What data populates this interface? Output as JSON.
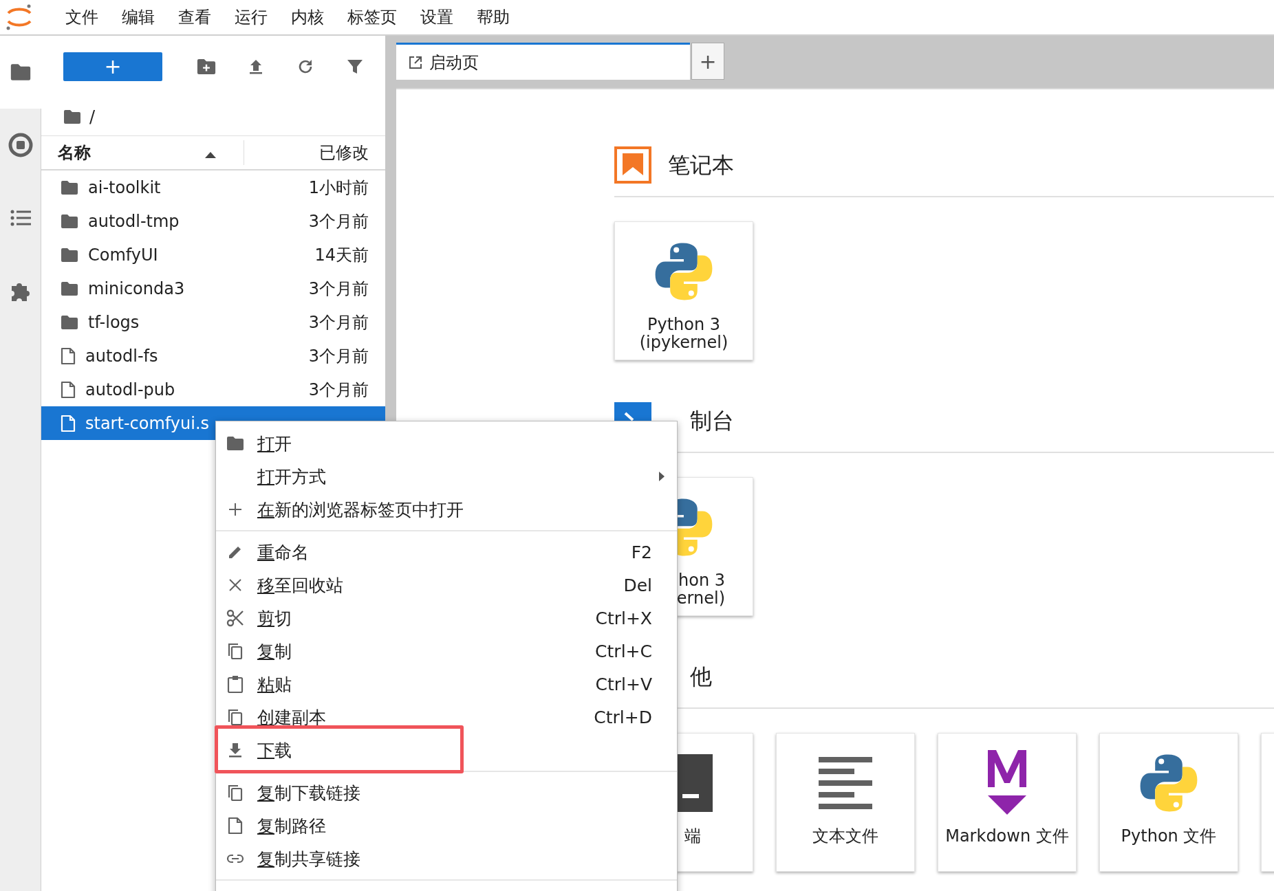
{
  "menu_bar": {
    "items": [
      "文件",
      "编辑",
      "查看",
      "运行",
      "内核",
      "标签页",
      "设置",
      "帮助"
    ]
  },
  "side_tabs": [
    {
      "selected": true
    },
    {
      "selected": false
    },
    {
      "selected": false
    },
    {
      "selected": false
    }
  ],
  "file_browser": {
    "new_button": "+",
    "breadcrumb": "/",
    "columns": [
      "名称",
      "已修改"
    ],
    "rows": [
      {
        "kind": "folder",
        "name": "ai-toolkit",
        "modified": "1小时前",
        "selected": false
      },
      {
        "kind": "folder",
        "name": "autodl-tmp",
        "modified": "3个月前",
        "selected": false
      },
      {
        "kind": "folder",
        "name": "ComfyUI",
        "modified": "14天前",
        "selected": false
      },
      {
        "kind": "folder",
        "name": "miniconda3",
        "modified": "3个月前",
        "selected": false
      },
      {
        "kind": "folder",
        "name": "tf-logs",
        "modified": "3个月前",
        "selected": false
      },
      {
        "kind": "file",
        "name": "autodl-fs",
        "modified": "3个月前",
        "selected": false
      },
      {
        "kind": "file",
        "name": "autodl-pub",
        "modified": "3个月前",
        "selected": false
      },
      {
        "kind": "file",
        "name": "start-comfyui.s",
        "selected": true
      }
    ]
  },
  "tabs": [
    {
      "label": "启动页",
      "selected": true
    },
    {
      "label": "+",
      "selected": false
    }
  ],
  "launcher": {
    "sections": [
      {
        "kind": "notebook",
        "title": "笔记本",
        "cards": [
          {
            "kind": "python",
            "label": "Python 3\n(ipykernel)",
            "clipped": false
          }
        ]
      },
      {
        "kind": "console",
        "title": "制台",
        "clipped": true,
        "cards": [
          {
            "kind": "python",
            "label": "hon 3\nernel)",
            "clipped": true
          }
        ]
      },
      {
        "kind": "other",
        "title": "他",
        "clipped": true,
        "cards": [
          {
            "kind": "terminal",
            "label": "端",
            "clipped": true
          },
          {
            "kind": "text",
            "label": "文本文件",
            "clipped": false
          },
          {
            "kind": "markdown",
            "label": "Markdown 文件",
            "clipped": false
          },
          {
            "kind": "python",
            "label": "Python 文件",
            "clipped": false
          },
          {
            "kind": "blank"
          }
        ]
      }
    ]
  },
  "context_menu": {
    "groups": [
      [
        {
          "label": "打开",
          "submenu": false,
          "outlined": false
        },
        {
          "label": "打开方式",
          "submenu": true,
          "outlined": false
        },
        {
          "label": "在新的浏览器标签页中打开",
          "submenu": false,
          "outlined": false
        }
      ],
      [
        {
          "label": "重命名",
          "shortcut": "F2",
          "submenu": false,
          "outlined": false
        },
        {
          "label": "移至回收站",
          "shortcut": "Del",
          "submenu": false,
          "outlined": false
        },
        {
          "label": "剪切",
          "shortcut": "Ctrl+X",
          "submenu": false,
          "outlined": false
        },
        {
          "label": "复制",
          "shortcut": "Ctrl+C",
          "submenu": false,
          "outlined": false
        },
        {
          "label": "粘贴",
          "shortcut": "Ctrl+V",
          "submenu": false,
          "outlined": false
        },
        {
          "label": "创建副本",
          "shortcut": "Ctrl+D",
          "submenu": false,
          "outlined": false
        },
        {
          "label": "下载",
          "submenu": false,
          "outlined": true
        }
      ],
      [
        {
          "label": "复制下载链接",
          "submenu": false,
          "outlined": false
        },
        {
          "label": "复制路径",
          "submenu": false,
          "outlined": false
        },
        {
          "label": "复制共享链接",
          "submenu": false,
          "outlined": false
        }
      ]
    ]
  }
}
